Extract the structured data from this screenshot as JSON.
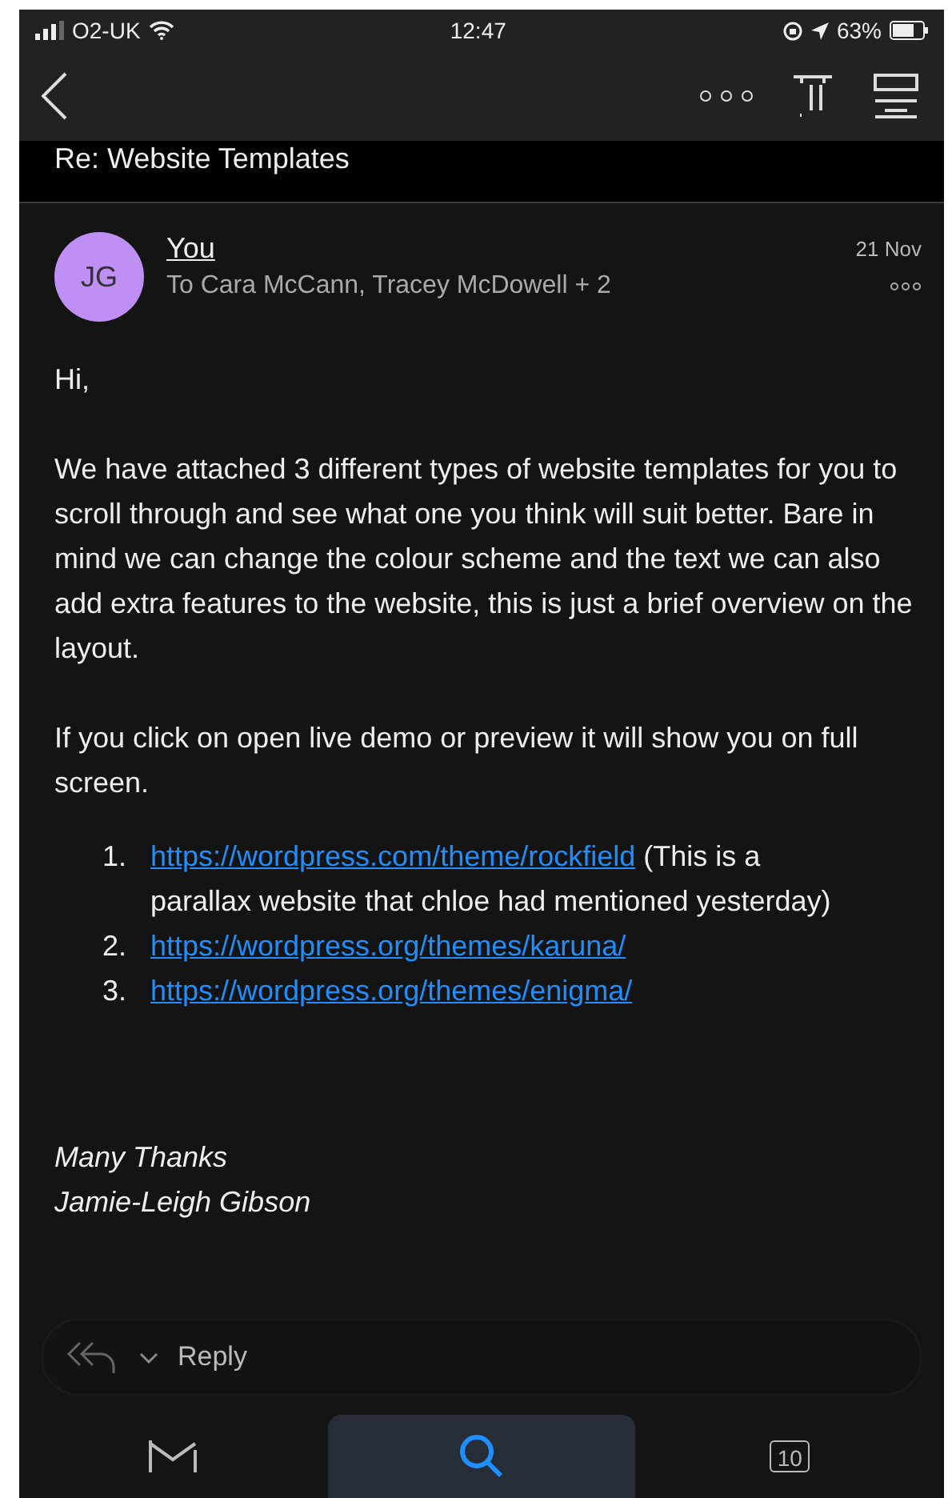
{
  "status_bar": {
    "carrier": "O2-UK",
    "time": "12:47",
    "battery": "63%"
  },
  "subject": "Re: Website Templates",
  "message": {
    "avatar": "JG",
    "sender": "You",
    "recipients": "To Cara McCann, Tracey McDowell + 2",
    "date": "21 Nov",
    "greeting": "Hi,",
    "paragraphs": [
      "We have attached 3 different types of website templates for you to scroll through and see what one you think will suit better. Bare in mind we can change the colour scheme and the text we can also add extra features to the website, this is just a brief overview on the layout.",
      "If you click on open live demo or preview it will show you on full screen."
    ],
    "links": [
      {
        "number": "1.",
        "url": "https://wordpress.com/theme/rockfield",
        "note": "(This is a parallax website that chloe had mentioned yesterday)"
      },
      {
        "number": "2.",
        "url": "https://wordpress.org/themes/karuna/"
      },
      {
        "number": "3.",
        "url": "https://wordpress.org/themes/enigma/"
      }
    ],
    "signoff": [
      "Many Thanks",
      "Jamie-Leigh Gibson"
    ]
  },
  "reply_bar": {
    "label": "Reply"
  },
  "tabs": [
    {
      "kind": "mail",
      "selected": false
    },
    {
      "kind": "search",
      "selected": true
    },
    {
      "kind": "calendar",
      "label": "10",
      "selected": false
    }
  ]
}
